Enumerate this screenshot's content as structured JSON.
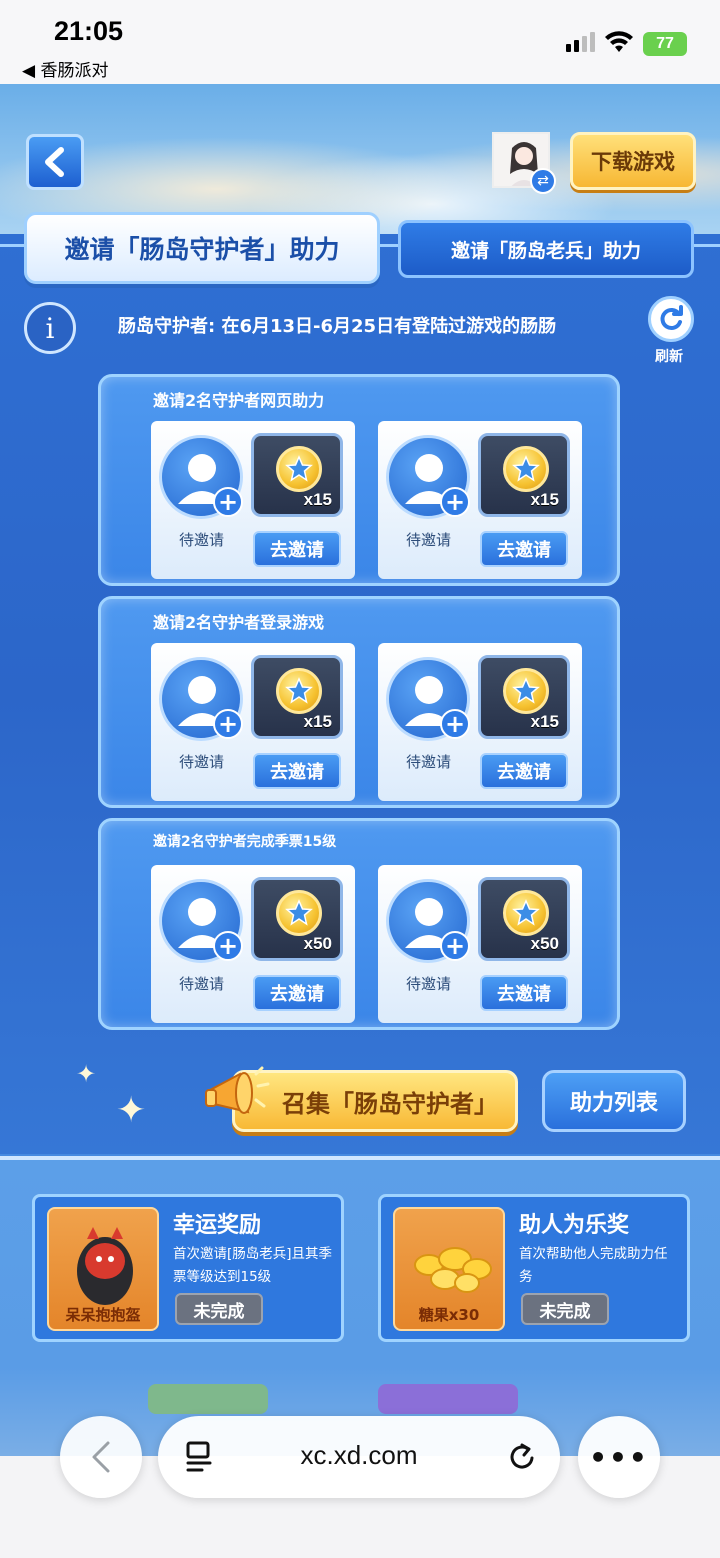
{
  "status_bar": {
    "time": "21:05",
    "back_app": "◀ 香肠派对",
    "battery": "77"
  },
  "header": {
    "download_label": "下载游戏"
  },
  "tabs": [
    {
      "label": "邀请「肠岛守护者」助力",
      "active": true
    },
    {
      "label": "邀请「肠岛老兵」助力",
      "active": false
    }
  ],
  "info": {
    "description": "肠岛守护者: 在6月13日-6月25日有登陆过游戏的肠肠",
    "refresh_label": "刷新"
  },
  "tasks": [
    {
      "title": "邀请2名守护者网页助力",
      "slots": [
        {
          "status": "待邀请",
          "reward_count": "x15",
          "button": "去邀请"
        },
        {
          "status": "待邀请",
          "reward_count": "x15",
          "button": "去邀请"
        }
      ]
    },
    {
      "title": "邀请2名守护者登录游戏",
      "slots": [
        {
          "status": "待邀请",
          "reward_count": "x15",
          "button": "去邀请"
        },
        {
          "status": "待邀请",
          "reward_count": "x15",
          "button": "去邀请"
        }
      ]
    },
    {
      "title": "邀请2名守护者完成季票15级",
      "slots": [
        {
          "status": "待邀请",
          "reward_count": "x50",
          "button": "去邀请"
        },
        {
          "status": "待邀请",
          "reward_count": "x50",
          "button": "去邀请"
        }
      ]
    }
  ],
  "actions": {
    "gather_label": "召集「肠岛守护者」",
    "list_label": "助力列表"
  },
  "rewards": [
    {
      "title": "幸运奖励",
      "description": "首次邀请[肠岛老兵]且其季票等级达到15级",
      "item_label": "呆呆抱抱盔",
      "status": "未完成"
    },
    {
      "title": "助人为乐奖",
      "description": "首次帮助他人完成助力任务",
      "item_label": "糖果x30",
      "status": "未完成"
    }
  ],
  "browser": {
    "url": "xc.xd.com"
  },
  "colors": {
    "accent_blue": "#2f7be6",
    "gold": "#f8b936",
    "incomplete_gray": "#6b7280"
  }
}
